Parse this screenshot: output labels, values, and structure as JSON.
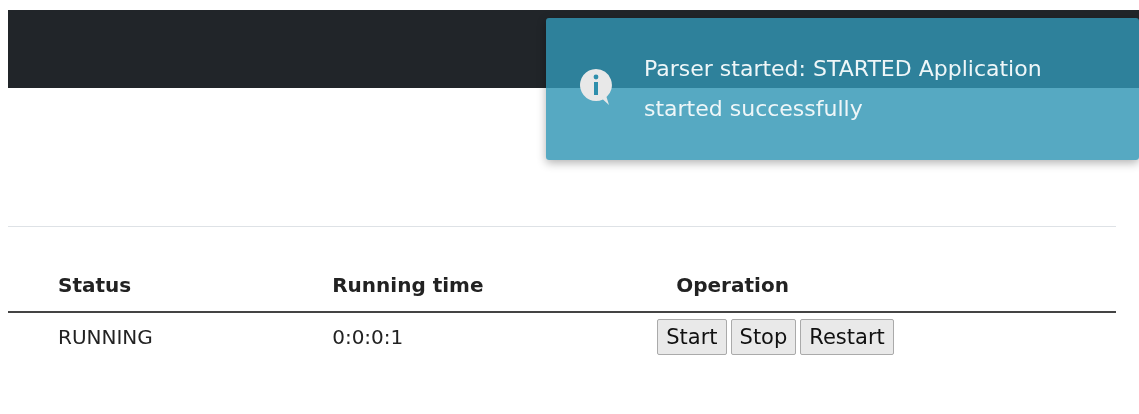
{
  "toast": {
    "message": "Parser started: STARTED Application started successfully"
  },
  "table": {
    "columns": [
      "Status",
      "Running time",
      "Operation"
    ],
    "rows": [
      {
        "status": "RUNNING",
        "running_time": "0:0:0:1",
        "buttons": [
          "Start",
          "Stop",
          "Restart"
        ]
      }
    ]
  }
}
